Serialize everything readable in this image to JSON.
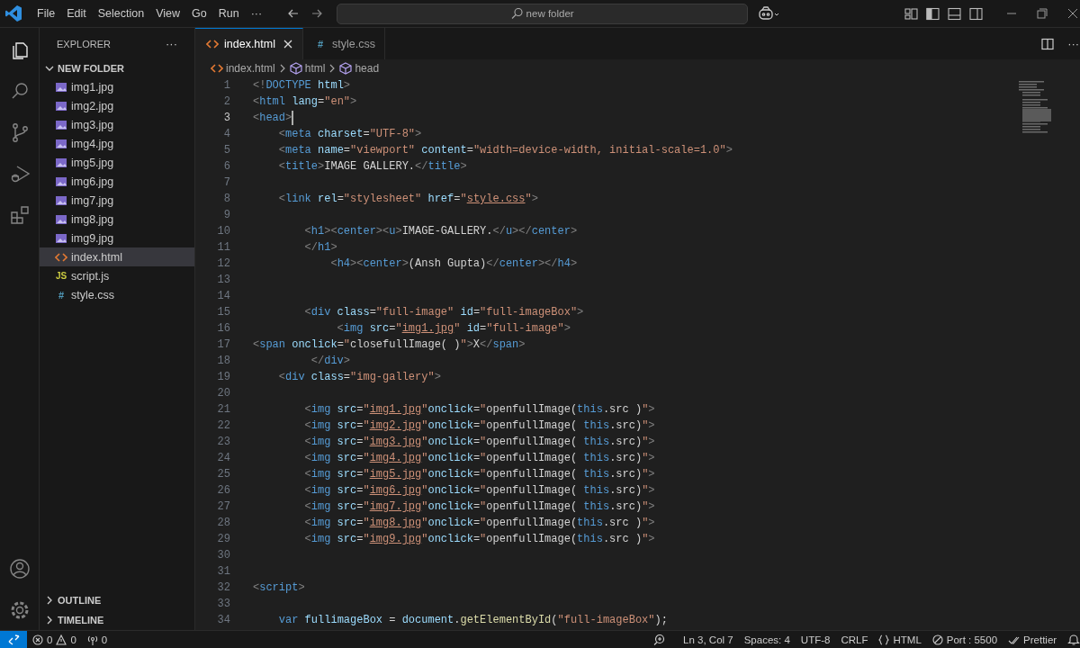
{
  "title_bar": {
    "menu": [
      "File",
      "Edit",
      "Selection",
      "View",
      "Go",
      "Run",
      "···"
    ],
    "search": {
      "value": "new folder"
    }
  },
  "activity_bar": {
    "items": [
      {
        "kind": "explorer",
        "selected": true
      },
      {
        "kind": "search",
        "selected": false
      },
      {
        "kind": "source-control",
        "selected": false
      },
      {
        "kind": "run-debug",
        "selected": false
      },
      {
        "kind": "extensions",
        "selected": false
      }
    ],
    "bottom": [
      {
        "kind": "accounts"
      },
      {
        "kind": "settings"
      }
    ]
  },
  "sidebar": {
    "title": "EXPLORER",
    "more": "···",
    "folder": {
      "label": "NEW FOLDER",
      "expanded": true,
      "children": [
        {
          "label": "img1.jpg",
          "kind": "image",
          "selected": false
        },
        {
          "label": "img2.jpg",
          "kind": "image",
          "selected": false
        },
        {
          "label": "img3.jpg",
          "kind": "image",
          "selected": false
        },
        {
          "label": "img4.jpg",
          "kind": "image",
          "selected": false
        },
        {
          "label": "img5.jpg",
          "kind": "image",
          "selected": false
        },
        {
          "label": "img6.jpg",
          "kind": "image",
          "selected": false
        },
        {
          "label": "img7.jpg",
          "kind": "image",
          "selected": false
        },
        {
          "label": "img8.jpg",
          "kind": "image",
          "selected": false
        },
        {
          "label": "img9.jpg",
          "kind": "image",
          "selected": false
        },
        {
          "label": "index.html",
          "kind": "html",
          "selected": true
        },
        {
          "label": "script.js",
          "kind": "js",
          "glyph": "JS",
          "selected": false
        },
        {
          "label": "style.css",
          "kind": "css",
          "glyph": "#",
          "selected": false
        }
      ]
    },
    "sections": [
      {
        "label": "OUTLINE",
        "expanded": false
      },
      {
        "label": "TIMELINE",
        "expanded": false
      }
    ]
  },
  "tabs": [
    {
      "label": "index.html",
      "kind": "html",
      "selected": true
    },
    {
      "label": "style.css",
      "kind": "css",
      "glyph": "#",
      "selected": false
    }
  ],
  "tab_bar": {
    "more": "···"
  },
  "breadcrumb": [
    {
      "label": "index.html",
      "kind": "html"
    },
    {
      "label": "html",
      "kind": "element"
    },
    {
      "label": "head",
      "kind": "element"
    }
  ],
  "editor": {
    "lines": [
      {
        "number": "1",
        "current": false,
        "tokens": [
          {
            "kind": "punct",
            "text": "<!"
          },
          {
            "kind": "tag",
            "text": "DOCTYPE"
          },
          {
            "kind": "attr",
            "text": " html"
          },
          {
            "kind": "punct",
            "text": ">"
          }
        ]
      },
      {
        "number": "2",
        "current": false,
        "tokens": [
          {
            "kind": "punct",
            "text": "<"
          },
          {
            "kind": "tag",
            "text": "html"
          },
          {
            "kind": "attr",
            "text": " lang"
          },
          {
            "kind": "text",
            "text": "="
          },
          {
            "kind": "string",
            "text": "\"en\""
          },
          {
            "kind": "punct",
            "text": ">"
          }
        ]
      },
      {
        "number": "3",
        "current": true,
        "tokens": [
          {
            "kind": "punct",
            "text": "<"
          },
          {
            "kind": "tag",
            "text": "head"
          },
          {
            "kind": "punct",
            "text": ">"
          }
        ]
      },
      {
        "number": "4",
        "current": false,
        "tokens": [
          {
            "kind": "punct",
            "text": "    <"
          },
          {
            "kind": "tag",
            "text": "meta"
          },
          {
            "kind": "attr",
            "text": " charset"
          },
          {
            "kind": "text",
            "text": "="
          },
          {
            "kind": "string",
            "text": "\"UTF-8\""
          },
          {
            "kind": "punct",
            "text": ">"
          }
        ]
      },
      {
        "number": "5",
        "current": false,
        "tokens": [
          {
            "kind": "punct",
            "text": "    <"
          },
          {
            "kind": "tag",
            "text": "meta"
          },
          {
            "kind": "attr",
            "text": " name"
          },
          {
            "kind": "text",
            "text": "="
          },
          {
            "kind": "string",
            "text": "\"viewport\""
          },
          {
            "kind": "attr",
            "text": " content"
          },
          {
            "kind": "text",
            "text": "="
          },
          {
            "kind": "string",
            "text": "\"width=device-width, initial-scale=1.0\""
          },
          {
            "kind": "punct",
            "text": ">"
          }
        ]
      },
      {
        "number": "6",
        "current": false,
        "tokens": [
          {
            "kind": "punct",
            "text": "    <"
          },
          {
            "kind": "tag",
            "text": "title"
          },
          {
            "kind": "punct",
            "text": ">"
          },
          {
            "kind": "text",
            "text": "IMAGE GALLERY."
          },
          {
            "kind": "punct",
            "text": "</"
          },
          {
            "kind": "tag",
            "text": "title"
          },
          {
            "kind": "punct",
            "text": ">"
          }
        ]
      },
      {
        "number": "7",
        "current": false
      },
      {
        "number": "8",
        "current": false,
        "tokens": [
          {
            "kind": "punct",
            "text": "    <"
          },
          {
            "kind": "tag",
            "text": "link"
          },
          {
            "kind": "attr",
            "text": " rel"
          },
          {
            "kind": "text",
            "text": "="
          },
          {
            "kind": "string",
            "text": "\"stylesheet\""
          },
          {
            "kind": "attr",
            "text": " href"
          },
          {
            "kind": "text",
            "text": "="
          },
          {
            "kind": "string",
            "text": "\""
          },
          {
            "kind": "link",
            "text": "style.css"
          },
          {
            "kind": "string",
            "text": "\""
          },
          {
            "kind": "punct",
            "text": ">"
          }
        ]
      },
      {
        "number": "9",
        "current": false
      },
      {
        "number": "10",
        "current": false,
        "tokens": [
          {
            "kind": "punct",
            "text": "        <"
          },
          {
            "kind": "tag",
            "text": "h1"
          },
          {
            "kind": "punct",
            "text": "><"
          },
          {
            "kind": "tag",
            "text": "center"
          },
          {
            "kind": "punct",
            "text": "><"
          },
          {
            "kind": "tag",
            "text": "u"
          },
          {
            "kind": "punct",
            "text": ">"
          },
          {
            "kind": "text",
            "text": "IMAGE-GALLERY."
          },
          {
            "kind": "punct",
            "text": "</"
          },
          {
            "kind": "tag",
            "text": "u"
          },
          {
            "kind": "punct",
            "text": "></"
          },
          {
            "kind": "tag",
            "text": "center"
          },
          {
            "kind": "punct",
            "text": ">"
          }
        ]
      },
      {
        "number": "11",
        "current": false,
        "tokens": [
          {
            "kind": "punct",
            "text": "        </"
          },
          {
            "kind": "tag",
            "text": "h1"
          },
          {
            "kind": "punct",
            "text": ">"
          }
        ]
      },
      {
        "number": "12",
        "current": false,
        "tokens": [
          {
            "kind": "punct",
            "text": "            <"
          },
          {
            "kind": "tag",
            "text": "h4"
          },
          {
            "kind": "punct",
            "text": "><"
          },
          {
            "kind": "tag",
            "text": "center"
          },
          {
            "kind": "punct",
            "text": ">"
          },
          {
            "kind": "text",
            "text": "(Ansh Gupta)"
          },
          {
            "kind": "punct",
            "text": "</"
          },
          {
            "kind": "tag",
            "text": "center"
          },
          {
            "kind": "punct",
            "text": "></"
          },
          {
            "kind": "tag",
            "text": "h4"
          },
          {
            "kind": "punct",
            "text": ">"
          }
        ]
      },
      {
        "number": "13",
        "current": false
      },
      {
        "number": "14",
        "current": false
      },
      {
        "number": "15",
        "current": false,
        "tokens": [
          {
            "kind": "punct",
            "text": "        <"
          },
          {
            "kind": "tag",
            "text": "div"
          },
          {
            "kind": "attr",
            "text": " class"
          },
          {
            "kind": "text",
            "text": "="
          },
          {
            "kind": "string",
            "text": "\"full-image\""
          },
          {
            "kind": "attr",
            "text": " id"
          },
          {
            "kind": "text",
            "text": "="
          },
          {
            "kind": "string",
            "text": "\"full-imageBox\""
          },
          {
            "kind": "punct",
            "text": ">"
          }
        ]
      },
      {
        "number": "16",
        "current": false,
        "tokens": [
          {
            "kind": "punct",
            "text": "             <"
          },
          {
            "kind": "tag",
            "text": "img"
          },
          {
            "kind": "attr",
            "text": " src"
          },
          {
            "kind": "text",
            "text": "="
          },
          {
            "kind": "string",
            "text": "\""
          },
          {
            "kind": "link",
            "text": "img1.jpg"
          },
          {
            "kind": "string",
            "text": "\""
          },
          {
            "kind": "attr",
            "text": " id"
          },
          {
            "kind": "text",
            "text": "="
          },
          {
            "kind": "string",
            "text": "\"full-image\""
          },
          {
            "kind": "punct",
            "text": ">"
          }
        ]
      },
      {
        "number": "17",
        "current": false,
        "tokens": [
          {
            "kind": "punct",
            "text": "<"
          },
          {
            "kind": "tag",
            "text": "span"
          },
          {
            "kind": "attr",
            "text": " onclick"
          },
          {
            "kind": "text",
            "text": "="
          },
          {
            "kind": "string",
            "text": "\""
          },
          {
            "kind": "text",
            "text": "closefullImage( )"
          },
          {
            "kind": "string",
            "text": "\""
          },
          {
            "kind": "punct",
            "text": ">"
          },
          {
            "kind": "text",
            "text": "X"
          },
          {
            "kind": "punct",
            "text": "</"
          },
          {
            "kind": "tag",
            "text": "span"
          },
          {
            "kind": "punct",
            "text": ">"
          }
        ]
      },
      {
        "number": "18",
        "current": false,
        "tokens": [
          {
            "kind": "punct",
            "text": "         </"
          },
          {
            "kind": "tag",
            "text": "div"
          },
          {
            "kind": "punct",
            "text": ">"
          }
        ]
      },
      {
        "number": "19",
        "current": false,
        "tokens": [
          {
            "kind": "punct",
            "text": "    <"
          },
          {
            "kind": "tag",
            "text": "div"
          },
          {
            "kind": "attr",
            "text": " class"
          },
          {
            "kind": "text",
            "text": "="
          },
          {
            "kind": "string",
            "text": "\"img-gallery\""
          },
          {
            "kind": "punct",
            "text": ">"
          }
        ]
      },
      {
        "number": "20",
        "current": false
      },
      {
        "number": "21",
        "current": false,
        "tokens": [
          {
            "kind": "punct",
            "text": "        <"
          },
          {
            "kind": "tag",
            "text": "img"
          },
          {
            "kind": "attr",
            "text": " src"
          },
          {
            "kind": "text",
            "text": "="
          },
          {
            "kind": "string",
            "text": "\""
          },
          {
            "kind": "link",
            "text": "img1.jpg"
          },
          {
            "kind": "string",
            "text": "\""
          },
          {
            "kind": "attr",
            "text": "onclick"
          },
          {
            "kind": "text",
            "text": "="
          },
          {
            "kind": "string",
            "text": "\""
          },
          {
            "kind": "text",
            "text": "openfullImage("
          },
          {
            "kind": "keyword",
            "text": "this"
          },
          {
            "kind": "text",
            "text": ".src )"
          },
          {
            "kind": "string",
            "text": "\""
          },
          {
            "kind": "punct",
            "text": ">"
          }
        ]
      },
      {
        "number": "22",
        "current": false,
        "tokens": [
          {
            "kind": "punct",
            "text": "        <"
          },
          {
            "kind": "tag",
            "text": "img"
          },
          {
            "kind": "attr",
            "text": " src"
          },
          {
            "kind": "text",
            "text": "="
          },
          {
            "kind": "string",
            "text": "\""
          },
          {
            "kind": "link",
            "text": "img2.jpg"
          },
          {
            "kind": "string",
            "text": "\""
          },
          {
            "kind": "attr",
            "text": "onclick"
          },
          {
            "kind": "text",
            "text": "="
          },
          {
            "kind": "string",
            "text": "\""
          },
          {
            "kind": "text",
            "text": "openfullImage( "
          },
          {
            "kind": "keyword",
            "text": "this"
          },
          {
            "kind": "text",
            "text": ".src)"
          },
          {
            "kind": "string",
            "text": "\""
          },
          {
            "kind": "punct",
            "text": ">"
          }
        ]
      },
      {
        "number": "23",
        "current": false,
        "tokens": [
          {
            "kind": "punct",
            "text": "        <"
          },
          {
            "kind": "tag",
            "text": "img"
          },
          {
            "kind": "attr",
            "text": " src"
          },
          {
            "kind": "text",
            "text": "="
          },
          {
            "kind": "string",
            "text": "\""
          },
          {
            "kind": "link",
            "text": "img3.jpg"
          },
          {
            "kind": "string",
            "text": "\""
          },
          {
            "kind": "attr",
            "text": "onclick"
          },
          {
            "kind": "text",
            "text": "="
          },
          {
            "kind": "string",
            "text": "\""
          },
          {
            "kind": "text",
            "text": "openfullImage( "
          },
          {
            "kind": "keyword",
            "text": "this"
          },
          {
            "kind": "text",
            "text": ".src)"
          },
          {
            "kind": "string",
            "text": "\""
          },
          {
            "kind": "punct",
            "text": ">"
          }
        ]
      },
      {
        "number": "24",
        "current": false,
        "tokens": [
          {
            "kind": "punct",
            "text": "        <"
          },
          {
            "kind": "tag",
            "text": "img"
          },
          {
            "kind": "attr",
            "text": " src"
          },
          {
            "kind": "text",
            "text": "="
          },
          {
            "kind": "string",
            "text": "\""
          },
          {
            "kind": "link",
            "text": "img4.jpg"
          },
          {
            "kind": "string",
            "text": "\""
          },
          {
            "kind": "attr",
            "text": "onclick"
          },
          {
            "kind": "text",
            "text": "="
          },
          {
            "kind": "string",
            "text": "\""
          },
          {
            "kind": "text",
            "text": "openfullImage( "
          },
          {
            "kind": "keyword",
            "text": "this"
          },
          {
            "kind": "text",
            "text": ".src)"
          },
          {
            "kind": "string",
            "text": "\""
          },
          {
            "kind": "punct",
            "text": ">"
          }
        ]
      },
      {
        "number": "25",
        "current": false,
        "tokens": [
          {
            "kind": "punct",
            "text": "        <"
          },
          {
            "kind": "tag",
            "text": "img"
          },
          {
            "kind": "attr",
            "text": " src"
          },
          {
            "kind": "text",
            "text": "="
          },
          {
            "kind": "string",
            "text": "\""
          },
          {
            "kind": "link",
            "text": "img5.jpg"
          },
          {
            "kind": "string",
            "text": "\""
          },
          {
            "kind": "attr",
            "text": "onclick"
          },
          {
            "kind": "text",
            "text": "="
          },
          {
            "kind": "string",
            "text": "\""
          },
          {
            "kind": "text",
            "text": "openfullImage( "
          },
          {
            "kind": "keyword",
            "text": "this"
          },
          {
            "kind": "text",
            "text": ".src)"
          },
          {
            "kind": "string",
            "text": "\""
          },
          {
            "kind": "punct",
            "text": ">"
          }
        ]
      },
      {
        "number": "26",
        "current": false,
        "tokens": [
          {
            "kind": "punct",
            "text": "        <"
          },
          {
            "kind": "tag",
            "text": "img"
          },
          {
            "kind": "attr",
            "text": " src"
          },
          {
            "kind": "text",
            "text": "="
          },
          {
            "kind": "string",
            "text": "\""
          },
          {
            "kind": "link",
            "text": "img6.jpg"
          },
          {
            "kind": "string",
            "text": "\""
          },
          {
            "kind": "attr",
            "text": "onclick"
          },
          {
            "kind": "text",
            "text": "="
          },
          {
            "kind": "string",
            "text": "\""
          },
          {
            "kind": "text",
            "text": "openfullImage( "
          },
          {
            "kind": "keyword",
            "text": "this"
          },
          {
            "kind": "text",
            "text": ".src)"
          },
          {
            "kind": "string",
            "text": "\""
          },
          {
            "kind": "punct",
            "text": ">"
          }
        ]
      },
      {
        "number": "27",
        "current": false,
        "tokens": [
          {
            "kind": "punct",
            "text": "        <"
          },
          {
            "kind": "tag",
            "text": "img"
          },
          {
            "kind": "attr",
            "text": " src"
          },
          {
            "kind": "text",
            "text": "="
          },
          {
            "kind": "string",
            "text": "\""
          },
          {
            "kind": "link",
            "text": "img7.jpg"
          },
          {
            "kind": "string",
            "text": "\""
          },
          {
            "kind": "attr",
            "text": "onclick"
          },
          {
            "kind": "text",
            "text": "="
          },
          {
            "kind": "string",
            "text": "\""
          },
          {
            "kind": "text",
            "text": "openfullImage( "
          },
          {
            "kind": "keyword",
            "text": "this"
          },
          {
            "kind": "text",
            "text": ".src)"
          },
          {
            "kind": "string",
            "text": "\""
          },
          {
            "kind": "punct",
            "text": ">"
          }
        ]
      },
      {
        "number": "28",
        "current": false,
        "tokens": [
          {
            "kind": "punct",
            "text": "        <"
          },
          {
            "kind": "tag",
            "text": "img"
          },
          {
            "kind": "attr",
            "text": " src"
          },
          {
            "kind": "text",
            "text": "="
          },
          {
            "kind": "string",
            "text": "\""
          },
          {
            "kind": "link",
            "text": "img8.jpg"
          },
          {
            "kind": "string",
            "text": "\""
          },
          {
            "kind": "attr",
            "text": "onclick"
          },
          {
            "kind": "text",
            "text": "="
          },
          {
            "kind": "string",
            "text": "\""
          },
          {
            "kind": "text",
            "text": "openfullImage("
          },
          {
            "kind": "keyword",
            "text": "this"
          },
          {
            "kind": "text",
            "text": ".src )"
          },
          {
            "kind": "string",
            "text": "\""
          },
          {
            "kind": "punct",
            "text": ">"
          }
        ]
      },
      {
        "number": "29",
        "current": false,
        "tokens": [
          {
            "kind": "punct",
            "text": "        <"
          },
          {
            "kind": "tag",
            "text": "img"
          },
          {
            "kind": "attr",
            "text": " src"
          },
          {
            "kind": "text",
            "text": "="
          },
          {
            "kind": "string",
            "text": "\""
          },
          {
            "kind": "link",
            "text": "img9.jpg"
          },
          {
            "kind": "string",
            "text": "\""
          },
          {
            "kind": "attr",
            "text": "onclick"
          },
          {
            "kind": "text",
            "text": "="
          },
          {
            "kind": "string",
            "text": "\""
          },
          {
            "kind": "text",
            "text": "openfullImage("
          },
          {
            "kind": "keyword",
            "text": "this"
          },
          {
            "kind": "text",
            "text": ".src )"
          },
          {
            "kind": "string",
            "text": "\""
          },
          {
            "kind": "punct",
            "text": ">"
          }
        ]
      },
      {
        "number": "30",
        "current": false
      },
      {
        "number": "31",
        "current": false
      },
      {
        "number": "32",
        "current": false,
        "tokens": [
          {
            "kind": "punct",
            "text": "<"
          },
          {
            "kind": "tag",
            "text": "script"
          },
          {
            "kind": "punct",
            "text": ">"
          }
        ]
      },
      {
        "number": "33",
        "current": false
      },
      {
        "number": "34",
        "current": false,
        "tokens": [
          {
            "kind": "keyword",
            "text": "    var"
          },
          {
            "kind": "variable",
            "text": " fullimageBox"
          },
          {
            "kind": "text",
            "text": " = "
          },
          {
            "kind": "variable",
            "text": "document"
          },
          {
            "kind": "text",
            "text": "."
          },
          {
            "kind": "function",
            "text": "getElementById"
          },
          {
            "kind": "text",
            "text": "("
          },
          {
            "kind": "string",
            "text": "\"full-imageBox\""
          },
          {
            "kind": "text",
            "text": ");"
          }
        ]
      }
    ]
  },
  "status_bar": {
    "errors": "0",
    "warnings": "0",
    "ports": "0",
    "items": [
      {
        "kind": "zoom"
      },
      {
        "kind": "text",
        "label": "Ln 3, Col 7"
      },
      {
        "kind": "text",
        "label": "Spaces: 4"
      },
      {
        "kind": "text",
        "label": "UTF-8"
      },
      {
        "kind": "text",
        "label": "CRLF"
      },
      {
        "kind": "language",
        "label": "HTML"
      },
      {
        "kind": "port",
        "label": "Port : 5500"
      },
      {
        "kind": "prettier",
        "label": "Prettier"
      },
      {
        "kind": "notifications"
      }
    ]
  }
}
